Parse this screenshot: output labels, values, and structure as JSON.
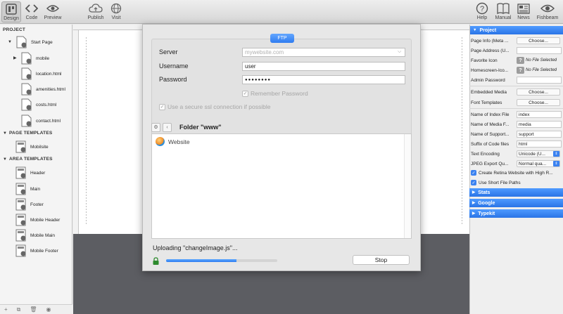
{
  "toolbar": {
    "design": "Design",
    "code": "Code",
    "preview": "Preview",
    "publish": "Publish",
    "visit": "Visit",
    "help": "Help",
    "manual": "Manual",
    "news": "News",
    "fishbeam": "Fishbeam"
  },
  "sidebar": {
    "project_title": "PROJECT",
    "project_items": [
      "Start Page",
      "mobile",
      "location.html",
      "amenities.html",
      "costs.html",
      "contact.html"
    ],
    "page_templates_title": "PAGE TEMPLATES",
    "page_templates": [
      "Mobilsite"
    ],
    "area_templates_title": "AREA TEMPLATES",
    "area_templates": [
      "Header",
      "Main",
      "Footer",
      "Mobile Header",
      "Mobile Main",
      "Mobile Footer"
    ]
  },
  "dialog": {
    "tab": "FTP",
    "server_label": "Server",
    "server_placeholder": "mywebsite.com",
    "username_label": "Username",
    "username_value": "user",
    "password_label": "Password",
    "password_value": "●●●●●●●●",
    "remember_label": "Remember Password",
    "ssl_label": "Use a secure ssl connection if possible",
    "folder_title": "Folder \"www\"",
    "file_item": "Website",
    "upload_status": "Uploading \"changeImage.js\"...",
    "progress": 0.63,
    "stop_label": "Stop"
  },
  "inspector": {
    "project_head": "Project",
    "rows": {
      "page_info": "Page Info (Meta ...",
      "page_address": "Page Address (U...",
      "favorite_icon": "Favorite Icon",
      "homescreen_icon": "Homescreen-Ico...",
      "admin_password": "Admin Password",
      "embedded_media": "Embedded Media",
      "font_templates": "Font Templates",
      "index_file": "Name of Index File",
      "media_folder": "Name of Media F...",
      "support_folder": "Name of Support...",
      "code_suffix": "Suffix of Code files",
      "text_encoding": "Text Encoding",
      "jpeg_quality": "JPEG Export Qu..."
    },
    "values": {
      "choose": "Choose...",
      "no_file": "No File Selected",
      "index": "index",
      "media": "media",
      "support": "support",
      "html": "html",
      "encoding": "Unicode (U...",
      "jpeg": "Normal qua..."
    },
    "retina_label": "Create Retina Website with High R...",
    "short_paths_label": "Use Short File Paths",
    "stats_head": "Stats",
    "google_head": "Google",
    "typekit_head": "Typekit"
  },
  "colors": {
    "accent": "#2f7cf0",
    "canvas": "#5c5d62"
  }
}
